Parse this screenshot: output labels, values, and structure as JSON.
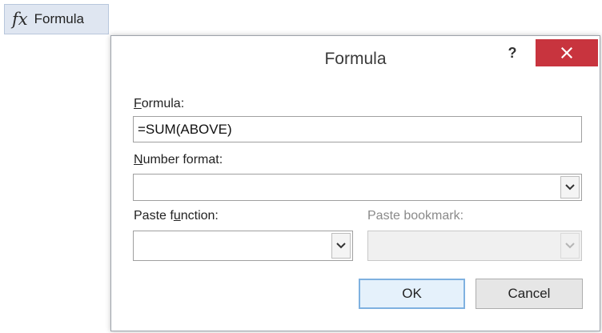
{
  "ribbon": {
    "icon": "fx-icon",
    "icon_glyph": "fx",
    "label": "Formula"
  },
  "dialog": {
    "title": "Formula",
    "help_glyph": "?",
    "close_glyph": "×",
    "close_color": "#c8343e",
    "formula": {
      "label_accel": "F",
      "label_rest": "ormula:",
      "value": "=SUM(ABOVE)"
    },
    "number_format": {
      "label_accel": "N",
      "label_rest": "umber format:",
      "value": ""
    },
    "paste_function": {
      "label_pre": "Paste f",
      "label_accel": "u",
      "label_post": "nction:",
      "value": ""
    },
    "paste_bookmark": {
      "label": "Paste bookmark:",
      "value": ""
    },
    "ok_label": "OK",
    "cancel_label": "Cancel"
  }
}
